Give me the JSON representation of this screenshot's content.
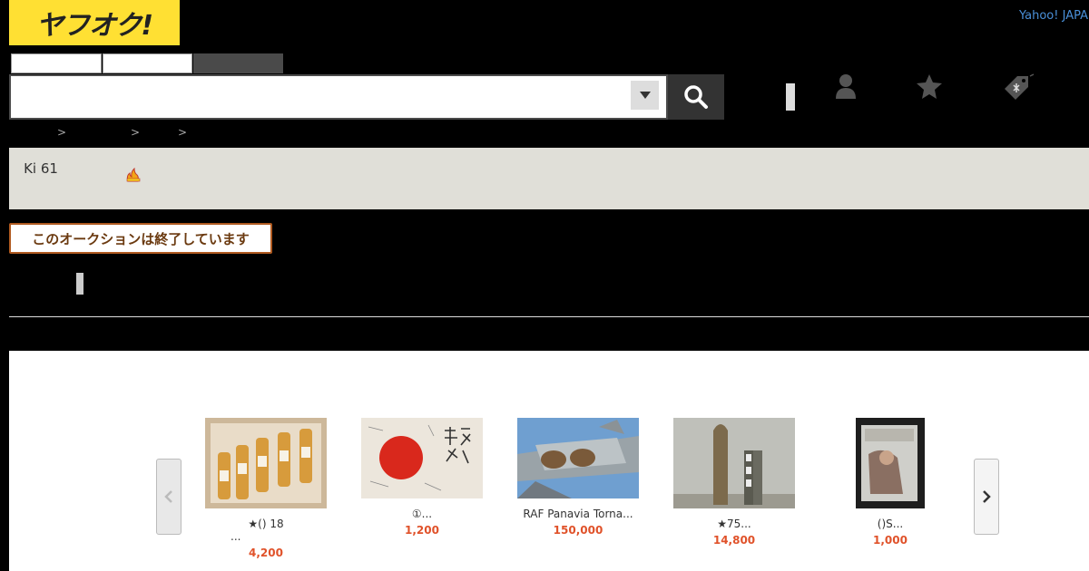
{
  "header": {
    "logo_text": "ヤフオク!",
    "yahoo_link": "Yahoo! JAPAN",
    "search": {
      "placeholder": "",
      "value": ""
    }
  },
  "breadcrumb": {
    "separator": ">"
  },
  "auction": {
    "title": "Ki 61",
    "status_badge": "このオークションは終了しています"
  },
  "carousel": {
    "items": [
      {
        "title": "★()  18",
        "title_line2": "...",
        "price": "4,200"
      },
      {
        "title": "①...",
        "title_line2": "",
        "price": "1,200"
      },
      {
        "title": "RAF Panavia Torna...",
        "title_line2": "",
        "price": "150,000"
      },
      {
        "title": "★75...",
        "title_line2": "",
        "price": "14,800"
      },
      {
        "title": "()S...",
        "title_line2": "",
        "price": "1,000"
      }
    ],
    "prev_icon": "chevron-left-icon",
    "next_icon": "chevron-right-icon"
  },
  "colors": {
    "logo_bg": "#ffe033",
    "price": "#e0522a",
    "badge_border": "#b05a20",
    "title_band": "#e0dfd8"
  }
}
